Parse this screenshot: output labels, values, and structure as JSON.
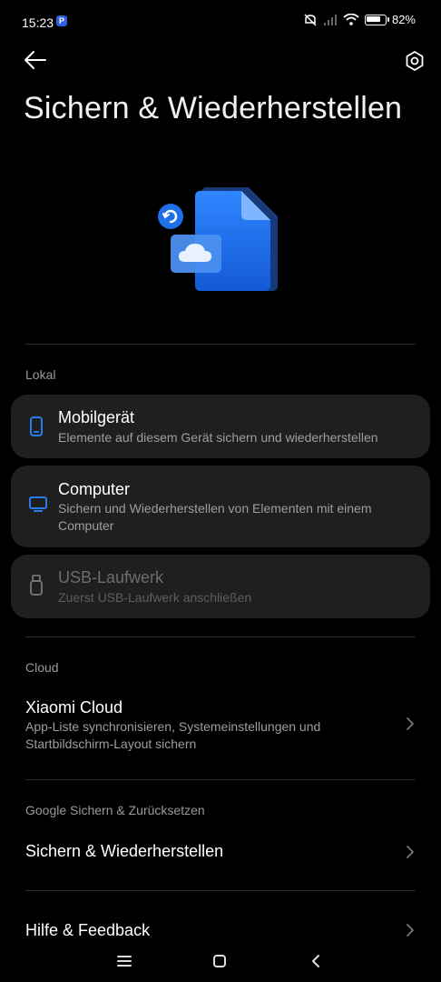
{
  "status": {
    "time": "15:23",
    "app_badge": "P",
    "battery": "82%",
    "battery_level": 0.82
  },
  "header": {
    "title": "Sichern & Wiederherstellen"
  },
  "sections": {
    "local": {
      "label": "Lokal",
      "items": [
        {
          "title": "Mobilgerät",
          "subtitle": "Elemente auf diesem Gerät sichern und wiederherstellen"
        },
        {
          "title": "Computer",
          "subtitle": "Sichern und Wiederherstellen von Elementen mit einem Computer"
        },
        {
          "title": "USB-Laufwerk",
          "subtitle": "Zuerst USB-Laufwerk anschließen"
        }
      ]
    },
    "cloud": {
      "label": "Cloud",
      "item": {
        "title": "Xiaomi Cloud",
        "subtitle": "App-Liste synchronisieren, Systemeinstellungen und Startbildschirm-Layout sichern"
      }
    },
    "google": {
      "label": "Google Sichern & Zurücksetzen",
      "item": {
        "title": "Sichern & Wiederherstellen"
      }
    },
    "help": {
      "item": {
        "title": "Hilfe & Feedback"
      }
    }
  },
  "colors": {
    "accent": "#2a7bef",
    "card_bg": "#1f1f1f",
    "background": "#000000"
  }
}
